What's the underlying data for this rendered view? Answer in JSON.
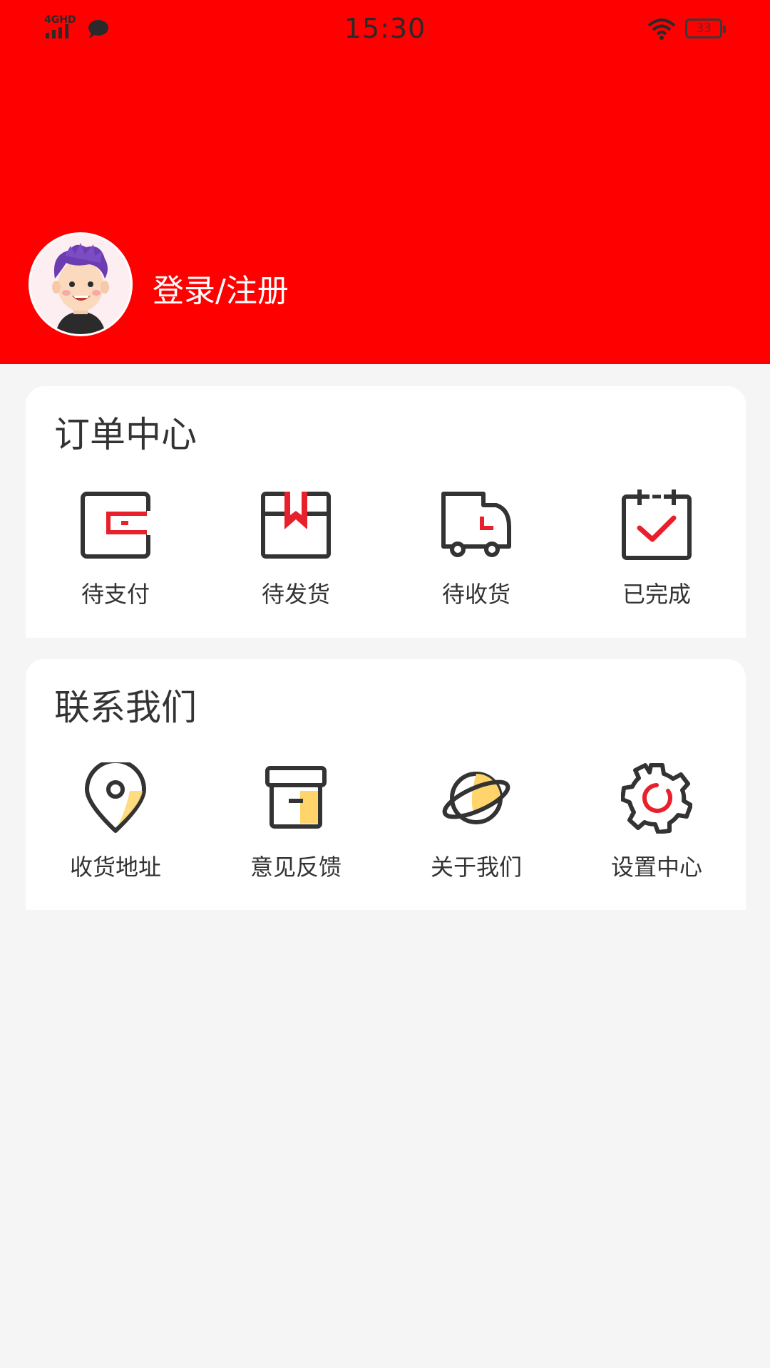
{
  "status_bar": {
    "time": "15:30",
    "network": "4GHD",
    "battery": "33"
  },
  "profile": {
    "login_label": "登录/注册"
  },
  "orders": {
    "title": "订单中心",
    "items": [
      {
        "label": "待支付",
        "icon": "wallet-icon"
      },
      {
        "label": "待发货",
        "icon": "package-icon"
      },
      {
        "label": "待收货",
        "icon": "truck-icon"
      },
      {
        "label": "已完成",
        "icon": "calendar-check-icon"
      }
    ]
  },
  "contact": {
    "title": "联系我们",
    "items": [
      {
        "label": "收货地址",
        "icon": "location-pin-icon"
      },
      {
        "label": "意见反馈",
        "icon": "archive-box-icon"
      },
      {
        "label": "关于我们",
        "icon": "planet-icon"
      },
      {
        "label": "设置中心",
        "icon": "gear-icon"
      }
    ]
  },
  "colors": {
    "brand_red": "#ff0000",
    "accent_red": "#e8202b",
    "accent_yellow": "#ffd56b",
    "background": "#f5f5f5"
  }
}
